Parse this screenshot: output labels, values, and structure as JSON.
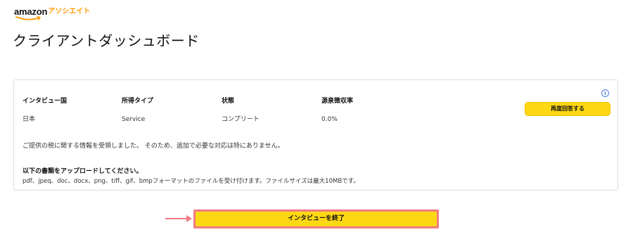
{
  "logo": {
    "word": "amazon",
    "sub": "アソシエイト"
  },
  "page_title": "クライアントダッシュボード",
  "columns": [
    {
      "header": "インタビュー国",
      "value": "日本"
    },
    {
      "header": "所得タイプ",
      "value": "Service"
    },
    {
      "header": "状態",
      "value": "コンプリート"
    },
    {
      "header": "源泉徴収率",
      "value": "0.0%"
    }
  ],
  "info_icon": "info-icon",
  "retry_button": "再度回答する",
  "message": "ご提供の税に関する情報を受領しました。 そのため、追加で必要な対応は特にありません。",
  "upload": {
    "title": "以下の書類をアップロードしてください。",
    "note": "pdf、jpeq、doc、docx、png、tiff、gif、bmpフォーマットのファイルを受け付けます。ファイルサイズは最大10MBです。"
  },
  "end_button": "インタビューを終了",
  "colors": {
    "accent": "#ffd814",
    "highlight_border": "#f07a86",
    "brand_orange": "#ff9900",
    "info_blue": "#4a7fd4"
  }
}
